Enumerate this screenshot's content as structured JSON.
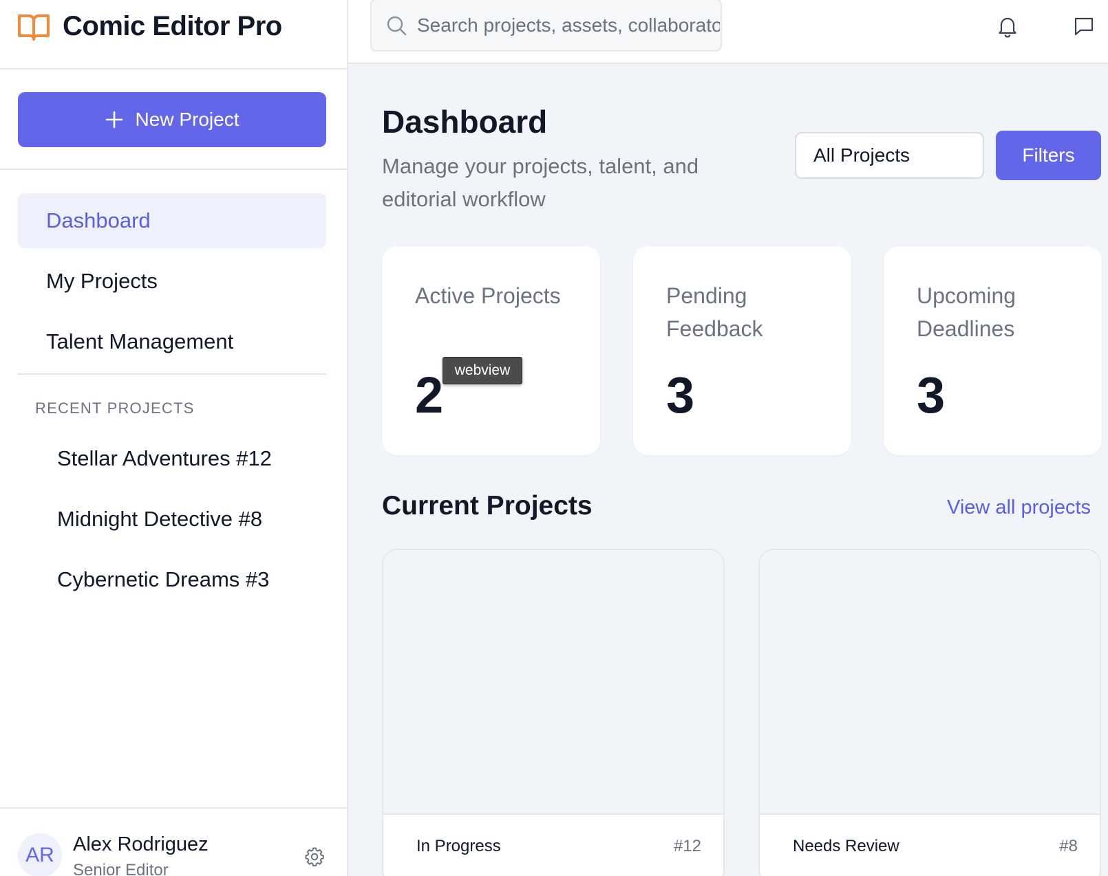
{
  "app": {
    "title": "Comic Editor Pro",
    "accent": "#6366e9",
    "logo_color": "#f08a3c"
  },
  "sidebar": {
    "new_project_label": "New Project",
    "nav": [
      {
        "label": "Dashboard",
        "active": true
      },
      {
        "label": "My Projects",
        "active": false
      },
      {
        "label": "Talent Management",
        "active": false
      }
    ],
    "recent_heading": "RECENT PROJECTS",
    "recent": [
      "Stellar Adventures #12",
      "Midnight Detective #8",
      "Cybernetic Dreams #3"
    ],
    "user": {
      "initials": "AR",
      "name": "Alex Rodriguez",
      "role": "Senior Editor"
    }
  },
  "topbar": {
    "search_placeholder": "Search projects, assets, collaborators...",
    "icons": [
      "bell-icon",
      "message-icon"
    ]
  },
  "main": {
    "title": "Dashboard",
    "subtitle": "Manage your projects, talent, and editorial workflow",
    "filter_select": "All Projects",
    "filters_label": "Filters",
    "stats": [
      {
        "label": "Active Projects",
        "value": "2"
      },
      {
        "label": "Pending Feedback",
        "value": "3"
      },
      {
        "label": "Upcoming Deadlines",
        "value": "3"
      }
    ],
    "tooltip": "webview",
    "current_title": "Current Projects",
    "view_all": "View all projects",
    "projects": [
      {
        "status": "In Progress",
        "issue": "#12"
      },
      {
        "status": "Needs Review",
        "issue": "#8"
      }
    ]
  }
}
